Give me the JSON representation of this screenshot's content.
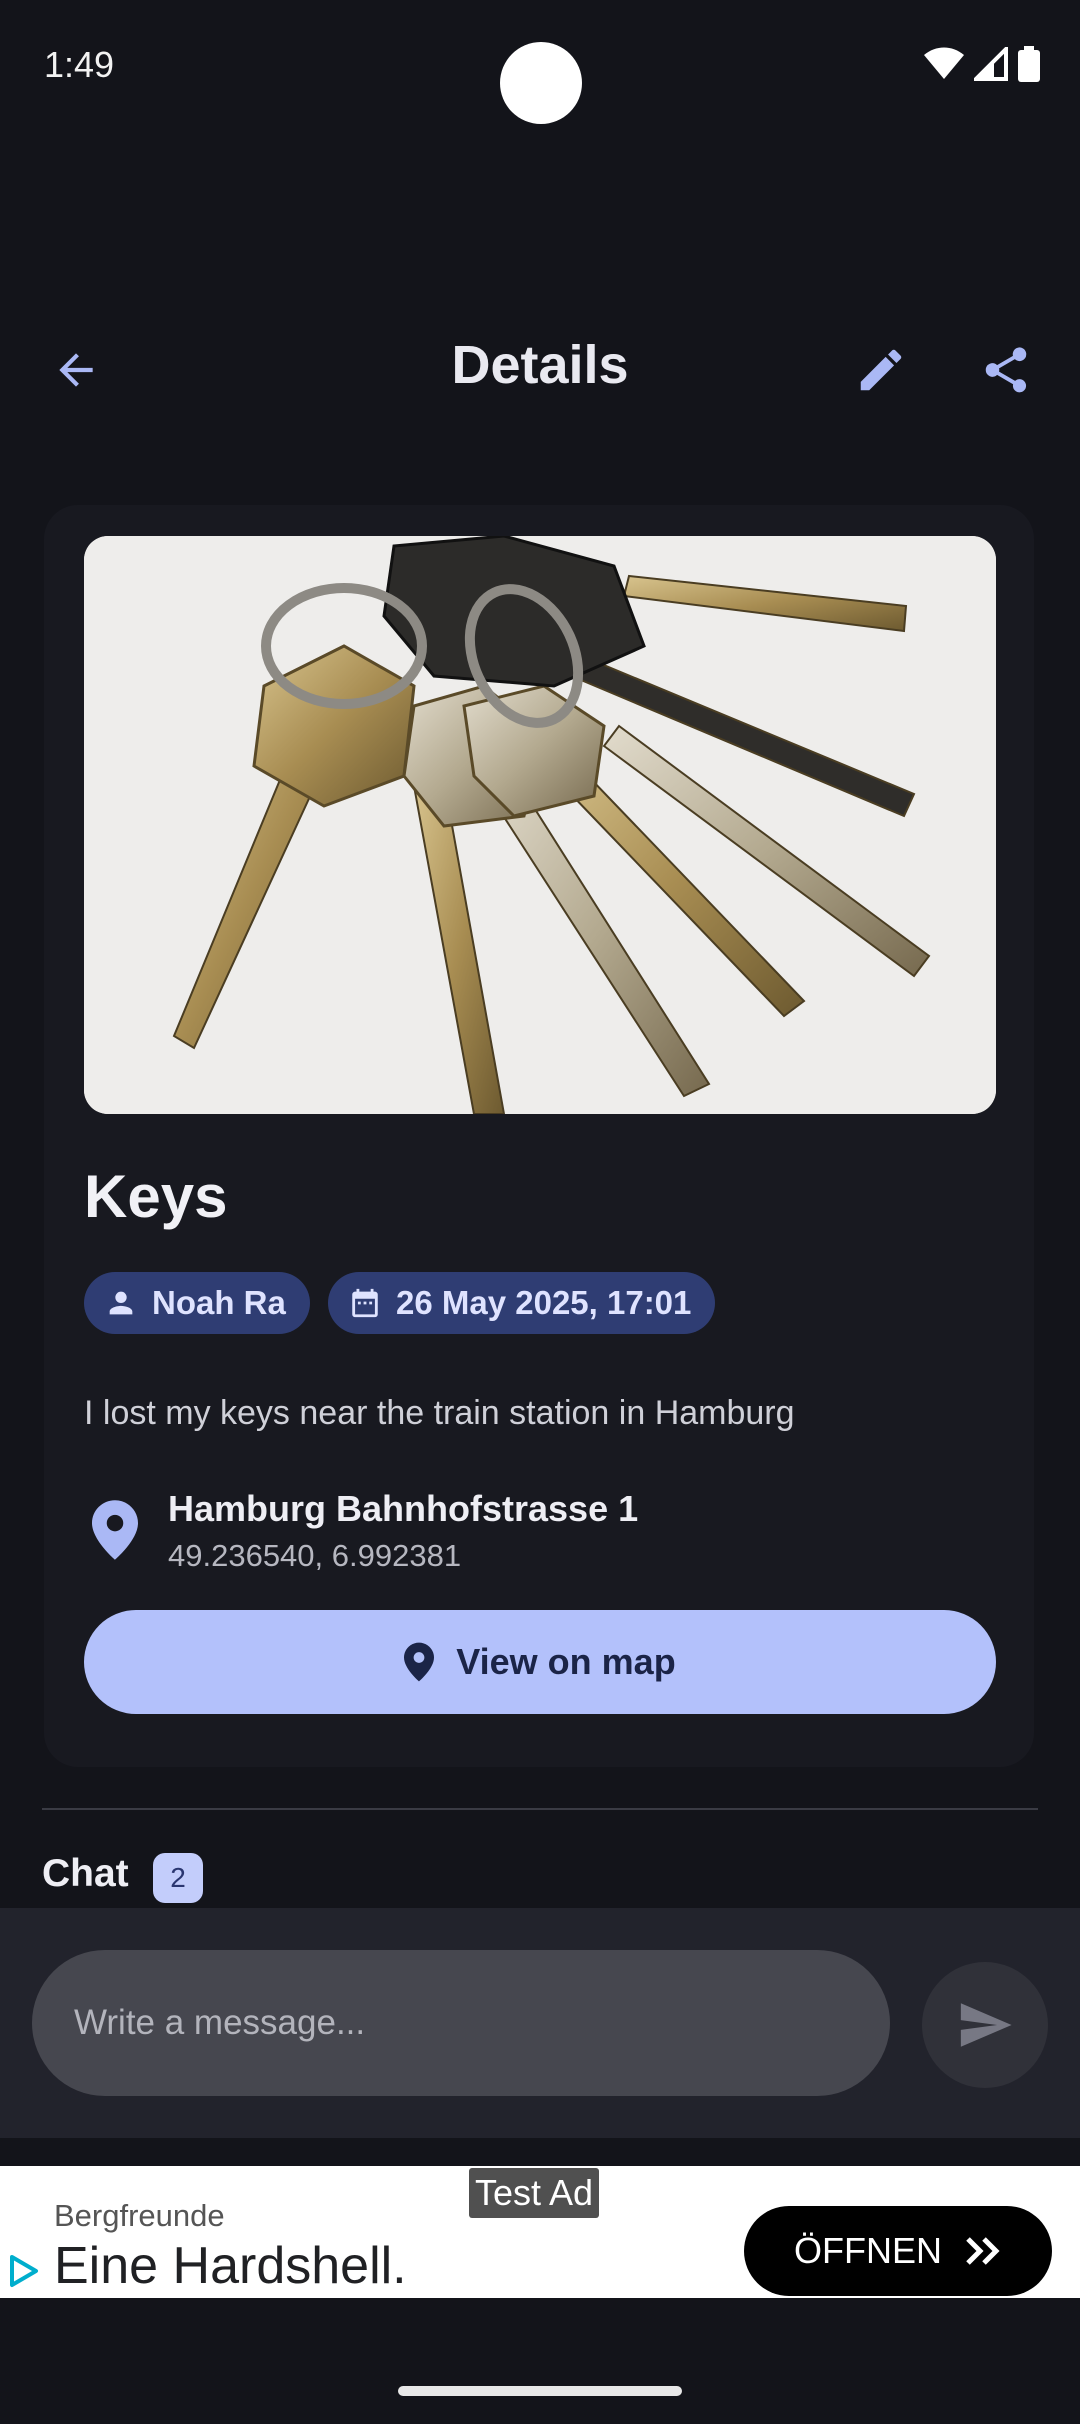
{
  "status_bar": {
    "time": "1:49"
  },
  "app_bar": {
    "title": "Details"
  },
  "item": {
    "title": "Keys",
    "author": "Noah Ra",
    "date": "26 May 2025, 17:01",
    "description": "I lost my keys near the train station in Hamburg",
    "location_name": "Hamburg Bahnhofstrasse 1",
    "coordinates": "49.236540, 6.992381",
    "map_button_label": "View on map"
  },
  "chat": {
    "label": "Chat",
    "count": "2",
    "input_placeholder": "Write a message..."
  },
  "ad": {
    "label": "Test Ad",
    "advertiser": "Bergfreunde",
    "headline": "Eine Hardshell.",
    "cta": "ÖFFNEN"
  },
  "colors": {
    "accent": "#b3c1fb",
    "chip_bg": "#2f3d73",
    "background": "#13141a",
    "card": "#181920"
  },
  "icons": [
    "back-arrow-icon",
    "edit-pencil-icon",
    "share-icon",
    "person-icon",
    "calendar-icon",
    "location-pin-icon",
    "send-icon",
    "ad-play-icon",
    "double-chevron-icon"
  ]
}
